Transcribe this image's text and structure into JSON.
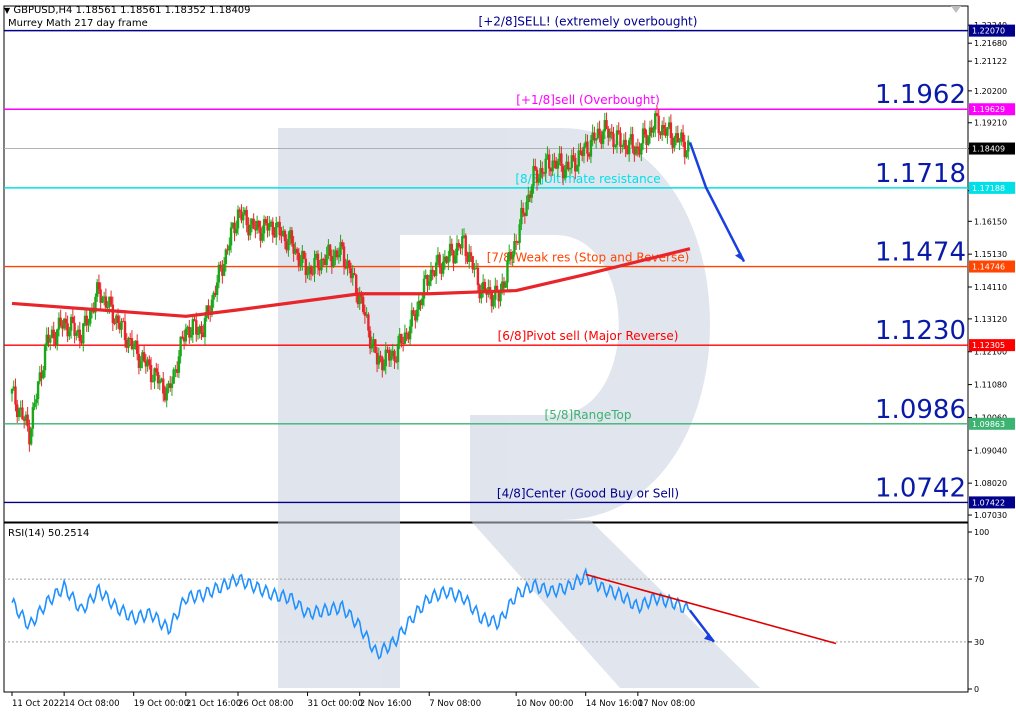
{
  "header": {
    "symbol_line": "GBPUSD,H4  1.18561 1.18561 1.18352 1.18409",
    "subtitle": "Murrey Math 217 day frame"
  },
  "rsi_panel": {
    "label": "RSI(14) 50.2514"
  },
  "chart_data": [
    {
      "type": "candlestick",
      "symbol": "GBPUSD",
      "timeframe": "H4",
      "last_bar": {
        "open": 1.18561,
        "high": 1.18561,
        "low": 1.18352,
        "close": 1.18409
      },
      "y_ticks": [
        "1.22240",
        "1.21680",
        "1.21122",
        "1.20200",
        "1.19210",
        "1.18409",
        "1.17100",
        "1.16150",
        "1.15130",
        "1.14110",
        "1.13120",
        "1.12100",
        "1.11080",
        "1.10060",
        "1.09040",
        "1.08020",
        "1.07030"
      ],
      "ylim": [
        1.07,
        1.224
      ],
      "x_ticks": [
        "11 Oct 2022",
        "14 Oct 08:00",
        "19 Oct 00:00",
        "21 Oct 16:00",
        "26 Oct 08:00",
        "31 Oct 00:00",
        "2 Nov 16:00",
        "7 Nov 08:00",
        "10 Nov 00:00",
        "14 Nov 16:00",
        "17 Nov 08:00"
      ],
      "price_path": [
        [
          "11 Oct 2022",
          1.108
        ],
        [
          "12 Oct",
          1.096
        ],
        [
          "13 Oct",
          1.124
        ],
        [
          "14 Oct 08:00",
          1.13
        ],
        [
          "15 Oct",
          1.126
        ],
        [
          "17 Oct",
          1.14
        ],
        [
          "18 Oct",
          1.131
        ],
        [
          "19 Oct 00:00",
          1.122
        ],
        [
          "20 Oct",
          1.115
        ],
        [
          "21 Oct",
          1.108
        ],
        [
          "21 Oct 16:00",
          1.128
        ],
        [
          "24 Oct",
          1.128
        ],
        [
          "25 Oct",
          1.146
        ],
        [
          "26 Oct 08:00",
          1.164
        ],
        [
          "27 Oct",
          1.159
        ],
        [
          "28 Oct",
          1.16
        ],
        [
          "29 Oct",
          1.155
        ],
        [
          "31 Oct 00:00",
          1.146
        ],
        [
          "1 Nov",
          1.15
        ],
        [
          "1 Nov 12:00",
          1.152
        ],
        [
          "2 Nov 16:00",
          1.138
        ],
        [
          "3 Nov",
          1.118
        ],
        [
          "4 Nov",
          1.12
        ],
        [
          "4 Nov 12:00",
          1.13
        ],
        [
          "7 Nov 08:00",
          1.145
        ],
        [
          "8 Nov",
          1.15
        ],
        [
          "8 Nov 12:00",
          1.155
        ],
        [
          "9 Nov",
          1.14
        ],
        [
          "9 Nov 12:00",
          1.138
        ],
        [
          "10 Nov 00:00",
          1.156
        ],
        [
          "10 Nov 12:00",
          1.175
        ],
        [
          "11 Nov",
          1.18
        ],
        [
          "14 Nov",
          1.178
        ],
        [
          "14 Nov 16:00",
          1.184
        ],
        [
          "15 Nov",
          1.19
        ],
        [
          "16 Nov",
          1.186
        ],
        [
          "17 Nov 08:00",
          1.184
        ],
        [
          "18 Nov",
          1.192
        ],
        [
          "18 Nov 08:00",
          1.188
        ],
        [
          "18 Nov 16:00",
          1.184
        ]
      ],
      "moving_average": [
        [
          "11 Oct 2022",
          1.136
        ],
        [
          "21 Oct 16:00",
          1.132
        ],
        [
          "26 Oct 08:00",
          1.134
        ],
        [
          "2 Nov 16:00",
          1.139
        ],
        [
          "7 Nov 08:00",
          1.139
        ],
        [
          "10 Nov 00:00",
          1.14
        ],
        [
          "14 Nov 16:00",
          1.145
        ],
        [
          "18 Nov 16:00",
          1.153
        ]
      ],
      "price_labels": [
        {
          "label": "[+2/8]SELL! (extremely overbought)",
          "value": 1.2207,
          "tag": "1.22070",
          "color": "#00008b"
        },
        {
          "label": "[+1/8]sell (Overbought)",
          "value": 1.19629,
          "tag": "1.19629",
          "big": "1.1962",
          "color": "#ff00ff"
        },
        {
          "label": "[8/8]Ultimate resistance",
          "value": 1.17188,
          "tag": "1.17188",
          "big": "1.1718",
          "color": "#00e0e8"
        },
        {
          "label": "[7/8]Weak res (Stop and Reverse)",
          "value": 1.14746,
          "tag": "1.14746",
          "big": "1.1474",
          "color": "#ff4500"
        },
        {
          "label": "[6/8]Pivot sell (Major Reverse)",
          "value": 1.12305,
          "tag": "1.12305",
          "big": "1.1230",
          "color": "#ff0000"
        },
        {
          "label": "[5/8]RangeTop",
          "value": 1.09863,
          "tag": "1.09863",
          "big": "1.0986",
          "color": "#3cb371"
        },
        {
          "label": "[4/8]Center (Good Buy or Sell)",
          "value": 1.07422,
          "tag": "1.07422",
          "big": "1.0742",
          "color": "#00008b"
        }
      ],
      "current_price": 1.18409,
      "forecast_arrow": [
        [
          "18 Nov 16:00",
          1.186
        ],
        [
          "19 Nov",
          1.172
        ],
        [
          "20 Nov",
          1.149
        ]
      ]
    },
    {
      "type": "line",
      "indicator": "RSI(14)",
      "current": 50.2514,
      "y_ticks": [
        "100",
        "70",
        "30",
        "0"
      ],
      "ylim": [
        0,
        100
      ],
      "levels": [
        70,
        30
      ],
      "values": [
        [
          "11 Oct 2022",
          55
        ],
        [
          "12 Oct",
          40
        ],
        [
          "13 Oct",
          55
        ],
        [
          "14 Oct 08:00",
          65
        ],
        [
          "15 Oct",
          50
        ],
        [
          "17 Oct",
          63
        ],
        [
          "18 Oct",
          52
        ],
        [
          "19 Oct 00:00",
          45
        ],
        [
          "20 Oct",
          48
        ],
        [
          "21 Oct",
          38
        ],
        [
          "21 Oct 16:00",
          58
        ],
        [
          "24 Oct",
          60
        ],
        [
          "25 Oct",
          65
        ],
        [
          "26 Oct 08:00",
          70
        ],
        [
          "27 Oct",
          65
        ],
        [
          "28 Oct",
          60
        ],
        [
          "29 Oct",
          58
        ],
        [
          "31 Oct 00:00",
          48
        ],
        [
          "1 Nov",
          50
        ],
        [
          "1 Nov 12:00",
          52
        ],
        [
          "2 Nov 16:00",
          40
        ],
        [
          "3 Nov",
          22
        ],
        [
          "4 Nov",
          30
        ],
        [
          "4 Nov 12:00",
          45
        ],
        [
          "7 Nov 08:00",
          58
        ],
        [
          "8 Nov",
          62
        ],
        [
          "8 Nov 12:00",
          58
        ],
        [
          "9 Nov",
          45
        ],
        [
          "9 Nov 12:00",
          42
        ],
        [
          "10 Nov 00:00",
          60
        ],
        [
          "10 Nov 12:00",
          66
        ],
        [
          "11 Nov",
          62
        ],
        [
          "14 Nov",
          65
        ],
        [
          "14 Nov 16:00",
          72
        ],
        [
          "15 Nov",
          64
        ],
        [
          "16 Nov",
          60
        ],
        [
          "17 Nov 08:00",
          52
        ],
        [
          "18 Nov",
          58
        ],
        [
          "18 Nov 08:00",
          55
        ],
        [
          "18 Nov 16:00",
          50
        ]
      ],
      "trendline": [
        [
          "14 Nov 16:00",
          73
        ],
        [
          "22 Nov",
          29
        ]
      ],
      "forecast_arrow": [
        [
          "18 Nov 16:00",
          50
        ],
        [
          "19 Nov",
          30
        ]
      ]
    }
  ],
  "colors": {
    "bull": "#1aa81a",
    "bear": "#e8252a",
    "ma": "#e8252a",
    "rsi": "#1e90ff",
    "arrow": "#1a3fe0",
    "watermark": "#c8d0e0"
  }
}
